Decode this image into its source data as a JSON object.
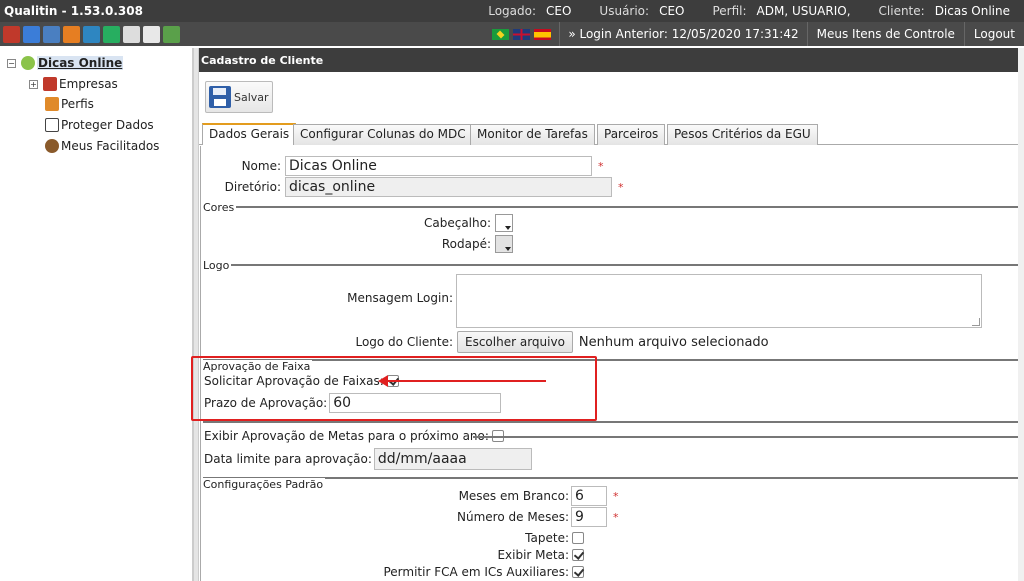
{
  "app": {
    "title": "Qualitin - 1.53.0.308",
    "user_info": [
      {
        "label": "Logado:",
        "value": "CEO"
      },
      {
        "label": "Usuário:",
        "value": "CEO"
      },
      {
        "label": "Perfil:",
        "value": "ADM, USUARIO,"
      },
      {
        "label": "Cliente:",
        "value": "Dicas Online"
      }
    ],
    "login_anterior": "» Login Anterior: 12/05/2020 17:31:42",
    "meus_itens": "Meus Itens de Controle",
    "logout": "Logout",
    "toolbar_icons": [
      "module-icon-1",
      "module-icon-2",
      "module-icon-3",
      "module-icon-4",
      "module-icon-5",
      "module-icon-6",
      "module-icon-7",
      "module-icon-8",
      "module-icon-9"
    ],
    "toolbar_icon_colors": [
      "#c0392b",
      "#3b7dd8",
      "#4a7fc1",
      "#e67e22",
      "#2e86c1",
      "#27ae60",
      "#dddddd",
      "#e8e8e8",
      "#5aa04a"
    ]
  },
  "sidebar": {
    "root": "Dicas Online",
    "items": [
      {
        "label": "Empresas",
        "icon": "companies-icon"
      },
      {
        "label": "Perfis",
        "icon": "profiles-icon"
      },
      {
        "label": "Proteger Dados",
        "icon": "calendar-lock-icon"
      },
      {
        "label": "Meus Facilitados",
        "icon": "user-icon"
      }
    ]
  },
  "main": {
    "header": "Cadastro de Cliente",
    "save_label": "Salvar",
    "tabs": [
      {
        "label": "Dados Gerais",
        "active": true
      },
      {
        "label": "Configurar Colunas do MDC",
        "active": false
      },
      {
        "label": "Monitor de Tarefas",
        "active": false
      },
      {
        "label": "Parceiros",
        "active": false
      },
      {
        "label": "Pesos Critérios da EGU",
        "active": false
      }
    ]
  },
  "form": {
    "nome_label": "Nome:",
    "nome_value": "Dicas Online",
    "diretorio_label": "Diretório:",
    "diretorio_value": "dicas_online",
    "required_mark": "*",
    "cores_legend": "Cores",
    "cabecalho_label": "Cabeçalho:",
    "rodape_label": "Rodapé:",
    "logo_legend": "Logo",
    "mensagem_login_label": "Mensagem Login:",
    "logo_cliente_label": "Logo do Cliente:",
    "choose_file": "Escolher arquivo",
    "no_file": "Nenhum arquivo selecionado",
    "aprovacao_legend": "Aprovação de Faixa",
    "solicitar_label": "Solicitar Aprovação de Faixas:",
    "solicitar_checked": true,
    "prazo_label": "Prazo de Aprovação:",
    "prazo_value": "60",
    "exibir_aprov_label": "Exibir Aprovação de Metas para o próximo ano:",
    "exibir_aprov_checked": false,
    "data_limite_label": "Data limite para aprovação:",
    "data_limite_placeholder": "dd/mm/aaaa",
    "config_legend": "Configurações Padrão",
    "meses_branco_label": "Meses em Branco:",
    "meses_branco_value": "6",
    "numero_meses_label": "Número de Meses:",
    "numero_meses_value": "9",
    "tapete_label": "Tapete:",
    "tapete_checked": false,
    "exibir_meta_label": "Exibir Meta:",
    "exibir_meta_checked": true,
    "permitir_fca_label": "Permitir FCA em ICs Auxiliares:",
    "permitir_fca_checked": true
  },
  "colors": {
    "highlight": "#e02020",
    "active_tab_accent": "#e39c1e",
    "header_bg": "#3d3d3d"
  }
}
